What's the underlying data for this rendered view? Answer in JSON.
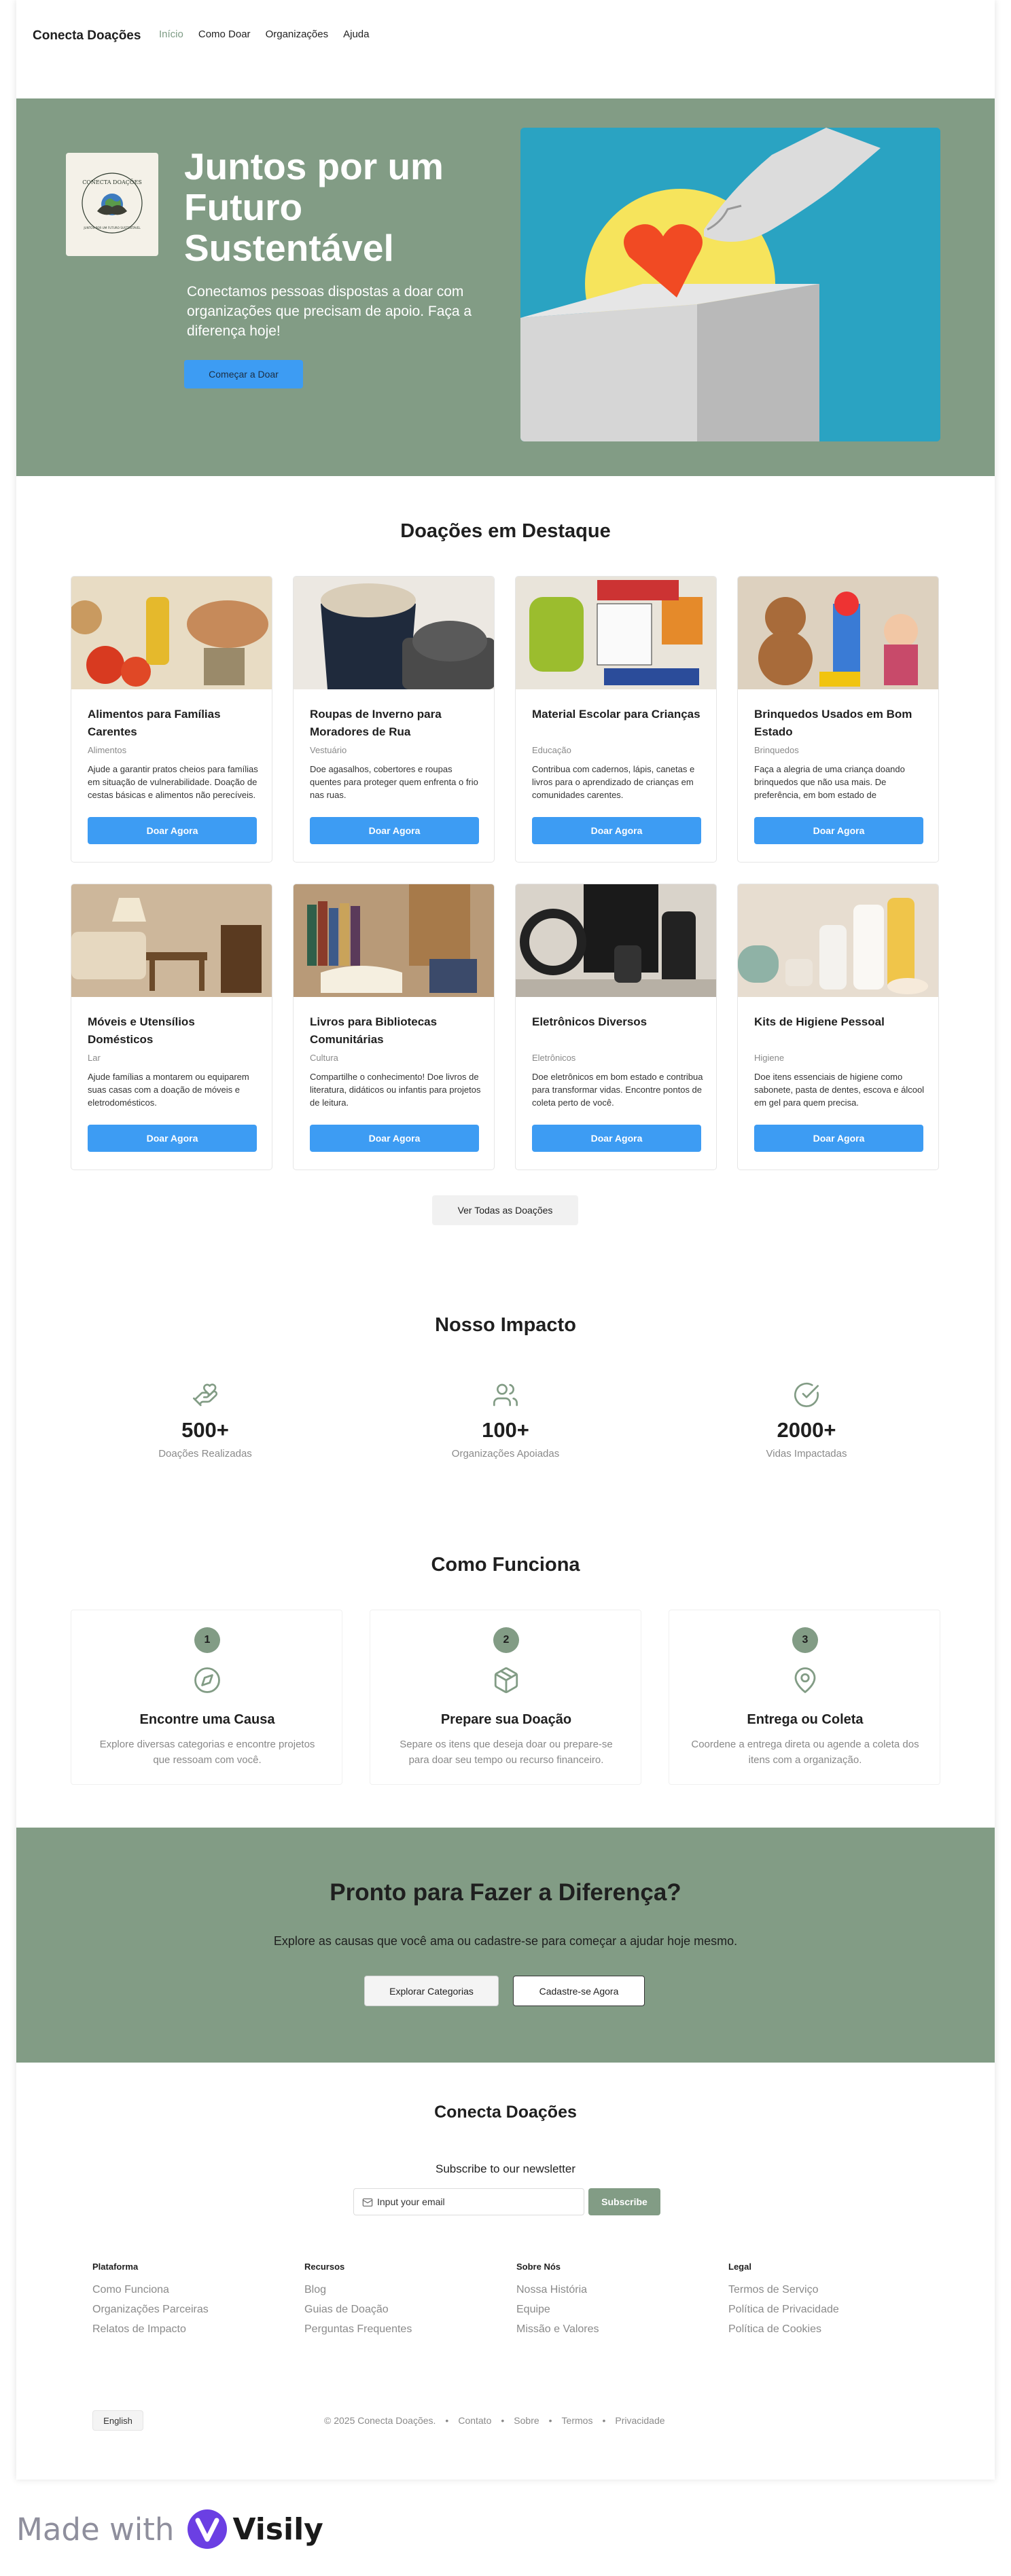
{
  "nav": {
    "brand": "Conecta Doações",
    "links": [
      "Início",
      "Como Doar",
      "Organizações",
      "Ajuda"
    ]
  },
  "hero": {
    "logo_text": "CONECTA DOAÇÕES",
    "logo_tagline": "JUNTOS POR UM FUTURO SUSTENTÁVEL",
    "title": "Juntos por um Futuro Sustentável",
    "subtitle": "Conectamos pessoas dispostas a doar com organizações que precisam de apoio. Faça a diferença hoje!",
    "cta": "Começar a Doar"
  },
  "featured": {
    "title": "Doações em Destaque",
    "donate_label": "Doar Agora",
    "cards": [
      {
        "title": "Alimentos para Famílias Carentes",
        "category": "Alimentos",
        "desc": "Ajude a garantir pratos cheios para famílias em situação de vulnerabilidade. Doação de cestas básicas e alimentos não perecíveis."
      },
      {
        "title": "Roupas de Inverno para Moradores de Rua",
        "category": "Vestuário",
        "desc": "Doe agasalhos, cobertores e roupas quentes para proteger quem enfrenta o frio nas ruas."
      },
      {
        "title": "Material Escolar para Crianças",
        "category": "Educação",
        "desc": "Contribua com cadernos, lápis, canetas e livros para o aprendizado de crianças em comunidades carentes."
      },
      {
        "title": "Brinquedos Usados em Bom Estado",
        "category": "Brinquedos",
        "desc": "Faça a alegria de uma criança doando brinquedos que não usa mais. De preferência, em bom estado de conservação."
      },
      {
        "title": "Móveis e Utensílios Domésticos",
        "category": "Lar",
        "desc": "Ajude famílias a montarem ou equiparem suas casas com a doação de móveis e eletrodomésticos."
      },
      {
        "title": "Livros para Bibliotecas Comunitárias",
        "category": "Cultura",
        "desc": "Compartilhe o conhecimento! Doe livros de literatura, didáticos ou infantis para projetos de leitura."
      },
      {
        "title": "Eletrônicos Diversos",
        "category": "Eletrônicos",
        "desc": "Doe eletrônicos em bom estado e contribua para transformar vidas. Encontre pontos de coleta perto de você."
      },
      {
        "title": "Kits de Higiene Pessoal",
        "category": "Higiene",
        "desc": "Doe itens essenciais de higiene como sabonete, pasta de dentes, escova e álcool em gel para quem precisa."
      }
    ],
    "see_all": "Ver Todas as Doações"
  },
  "impact": {
    "title": "Nosso Impacto",
    "stats": [
      {
        "icon": "hand-heart-icon",
        "value": "500+",
        "label": "Doações Realizadas"
      },
      {
        "icon": "users-icon",
        "value": "100+",
        "label": "Organizações Apoiadas"
      },
      {
        "icon": "check-circle-icon",
        "value": "2000+",
        "label": "Vidas Impactadas"
      }
    ]
  },
  "how": {
    "title": "Como Funciona",
    "steps": [
      {
        "num": "1",
        "icon": "compass-icon",
        "title": "Encontre uma Causa",
        "desc": "Explore diversas categorias e encontre projetos que ressoam com você."
      },
      {
        "num": "2",
        "icon": "box-icon",
        "title": "Prepare sua Doação",
        "desc": "Separe os itens que deseja doar ou prepare-se para doar seu tempo ou recurso financeiro."
      },
      {
        "num": "3",
        "icon": "map-pin-icon",
        "title": "Entrega ou Coleta",
        "desc": "Coordene a entrega direta ou agende a coleta dos itens com a organização."
      }
    ]
  },
  "cta": {
    "title": "Pronto para Fazer a Diferença?",
    "subtitle": "Explore as causas que você ama ou cadastre-se para começar a ajudar hoje mesmo.",
    "explore": "Explorar Categorias",
    "signup": "Cadastre-se Agora"
  },
  "footer": {
    "brand": "Conecta Doações",
    "newsletter_label": "Subscribe to our newsletter",
    "email_placeholder": "Input your email",
    "subscribe": "Subscribe",
    "columns": [
      {
        "head": "Plataforma",
        "links": [
          "Como Funciona",
          "Organizações Parceiras",
          "Relatos de Impacto"
        ]
      },
      {
        "head": "Recursos",
        "links": [
          "Blog",
          "Guias de Doação",
          "Perguntas Frequentes"
        ]
      },
      {
        "head": "Sobre Nós",
        "links": [
          "Nossa História",
          "Equipe",
          "Missão e Valores"
        ]
      },
      {
        "head": "Legal",
        "links": [
          "Termos de Serviço",
          "Política de Privacidade",
          "Política de Cookies"
        ]
      }
    ],
    "language": "English",
    "copyright": "© 2025 Conecta Doações.",
    "bottom_links": [
      "Contato",
      "Sobre",
      "Termos",
      "Privacidade"
    ]
  },
  "watermark": {
    "made_with": "Made with",
    "brand": "Visily"
  },
  "colors": {
    "sage": "#829c85",
    "blue": "#3d9cf3",
    "nav_active": "#7d9b84"
  }
}
